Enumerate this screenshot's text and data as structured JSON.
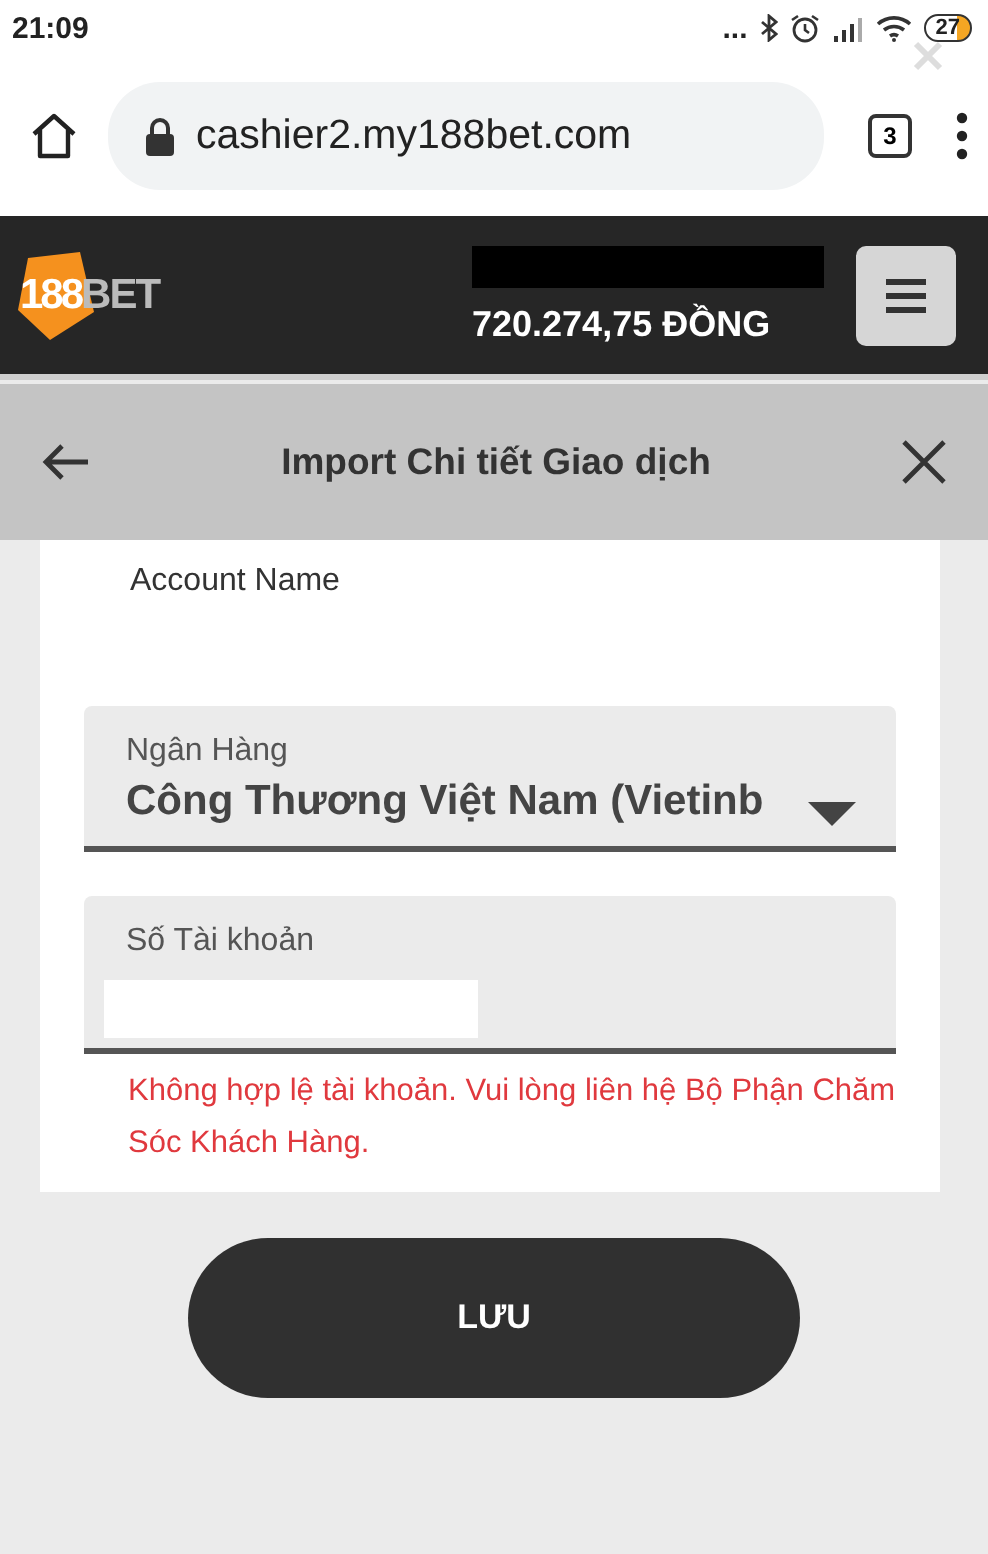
{
  "status_bar": {
    "time": "21:09",
    "dots": "...",
    "battery": "27"
  },
  "browser": {
    "url": "cashier2.my188bet.com",
    "tab_count": "3"
  },
  "header": {
    "logo_number": "188",
    "logo_word": "BET",
    "balance": "720.274,75 ĐỒNG"
  },
  "dialog": {
    "title": "Import Chi tiết Giao dịch"
  },
  "form": {
    "account_name_label": "Account Name",
    "bank": {
      "label": "Ngân Hàng",
      "value": "Công Thương Việt Nam (Vietinb"
    },
    "account_number": {
      "label": "Số Tài khoản",
      "invalid": true
    },
    "error": "Không hợp lệ tài khoản. Vui lòng liên hệ Bộ Phận Chăm Sóc Khách Hàng."
  },
  "save_button": "LƯU"
}
